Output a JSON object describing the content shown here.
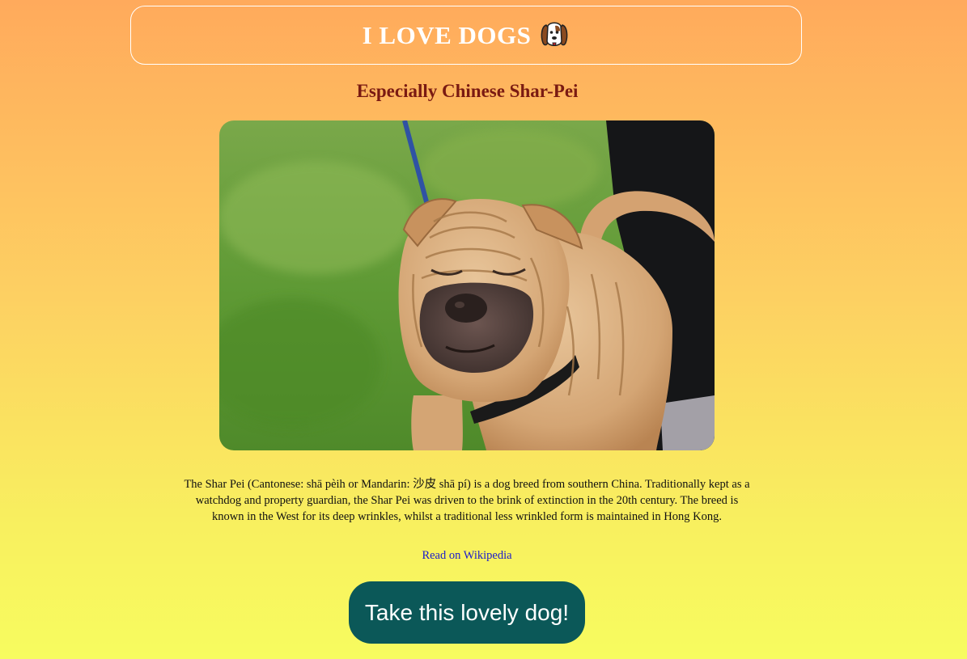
{
  "header": {
    "title": "I LOVE DOGS",
    "icon": "dog-face-icon"
  },
  "subtitle": "Especially Chinese Shar-Pei",
  "photo": {
    "subject": "shar-pei-dog-photo"
  },
  "description": "The Shar Pei (Cantonese: shā pèih or Mandarin: 沙皮 shā pí) is a dog breed from southern China. Traditionally kept as a watchdog and property guardian, the Shar Pei was driven to the brink of extinction in the 20th century. The breed is known in the West for its deep wrinkles, whilst a traditional less wrinkled form is maintained in Hong Kong.",
  "links": {
    "wikipedia": "Read on Wikipedia"
  },
  "cta": {
    "label": "Take this lovely dog!"
  },
  "colors": {
    "gradient_top": "#ffaa5c",
    "gradient_bottom": "#f7fc5f",
    "subtitle": "#7a1a12",
    "button_bg": "#0b5858",
    "link": "#1a1acc"
  }
}
